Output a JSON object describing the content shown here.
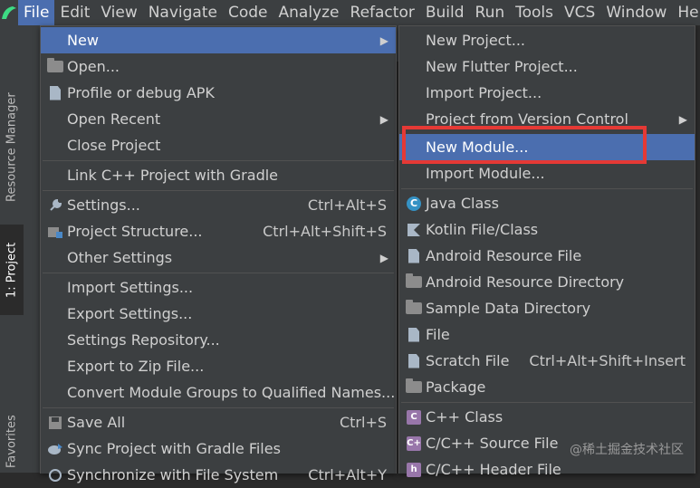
{
  "menubar": {
    "items": [
      "File",
      "Edit",
      "View",
      "Navigate",
      "Code",
      "Analyze",
      "Refactor",
      "Build",
      "Run",
      "Tools",
      "VCS",
      "Window",
      "Help"
    ]
  },
  "sidebar": {
    "tabs": [
      "Resource Manager",
      "1: Project",
      "Favorites"
    ]
  },
  "file_menu": {
    "new": "New",
    "open": "Open...",
    "profile": "Profile or debug APK",
    "open_recent": "Open Recent",
    "close_project": "Close Project",
    "link_cpp": "Link C++ Project with Gradle",
    "settings": "Settings...",
    "settings_sc": "Ctrl+Alt+S",
    "project_structure": "Project Structure...",
    "project_structure_sc": "Ctrl+Alt+Shift+S",
    "other_settings": "Other Settings",
    "import_settings": "Import Settings...",
    "export_settings": "Export Settings...",
    "settings_repo": "Settings Repository...",
    "export_zip": "Export to Zip File...",
    "convert_groups": "Convert Module Groups to Qualified Names...",
    "save_all": "Save All",
    "save_all_sc": "Ctrl+S",
    "sync_gradle": "Sync Project with Gradle Files",
    "sync_fs": "Synchronize with File System",
    "sync_fs_sc": "Ctrl+Alt+Y"
  },
  "new_menu": {
    "new_project": "New Project...",
    "new_flutter": "New Flutter Project...",
    "import_project": "Import Project...",
    "project_vcs": "Project from Version Control",
    "new_module": "New Module...",
    "import_module": "Import Module...",
    "java_class": "Java Class",
    "kotlin": "Kotlin File/Class",
    "android_res_file": "Android Resource File",
    "android_res_dir": "Android Resource Directory",
    "sample_data_dir": "Sample Data Directory",
    "file": "File",
    "scratch": "Scratch File",
    "scratch_sc": "Ctrl+Alt+Shift+Insert",
    "package": "Package",
    "cpp_class": "C++ Class",
    "cpp_source": "C/C++ Source File",
    "cpp_header": "C/C++ Header File"
  },
  "watermark": "@稀土掘金技术社区",
  "colors": {
    "selection": "#4b6eaf",
    "menu_bg": "#3c3f41",
    "highlight_box": "#e53935"
  }
}
